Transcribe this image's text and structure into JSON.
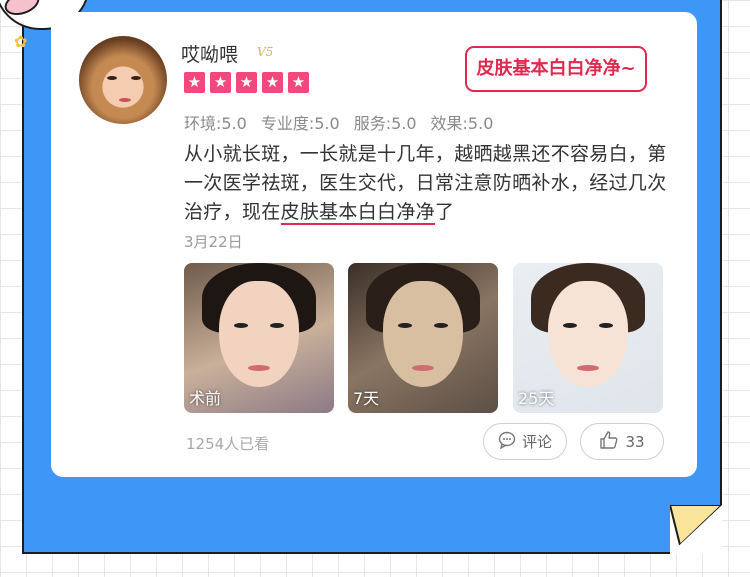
{
  "user": {
    "name": "哎呦喂",
    "level_badge": "V5",
    "star_count": 5
  },
  "tag": {
    "label": "皮肤基本白白净净~"
  },
  "ratings": [
    {
      "label": "环境:5.0"
    },
    {
      "label": "专业度:5.0"
    },
    {
      "label": "服务:5.0"
    },
    {
      "label": "效果:5.0"
    }
  ],
  "review": {
    "text_before": "从小就长斑，一长就是十几年，越晒越黑还不容易白，第一次医学祛斑，医生交代，日常注意防晒补水，经过几次治疗，现在",
    "highlight": "皮肤基本白白净净",
    "text_after": "了",
    "date": "3月22日"
  },
  "photos": [
    {
      "label": "术前"
    },
    {
      "label": "7天"
    },
    {
      "label": "25天"
    }
  ],
  "footer": {
    "views": "1254人已看",
    "comment_label": "评论",
    "like_count": "33"
  },
  "colors": {
    "frame_blue": "#3e96f6",
    "accent_red": "#e0294f",
    "star_pink": "#f2487e",
    "corner_yellow": "#fbe59a"
  },
  "icons": [
    "comment-icon",
    "thumbs-up-icon",
    "star-icon",
    "flower-icon"
  ]
}
